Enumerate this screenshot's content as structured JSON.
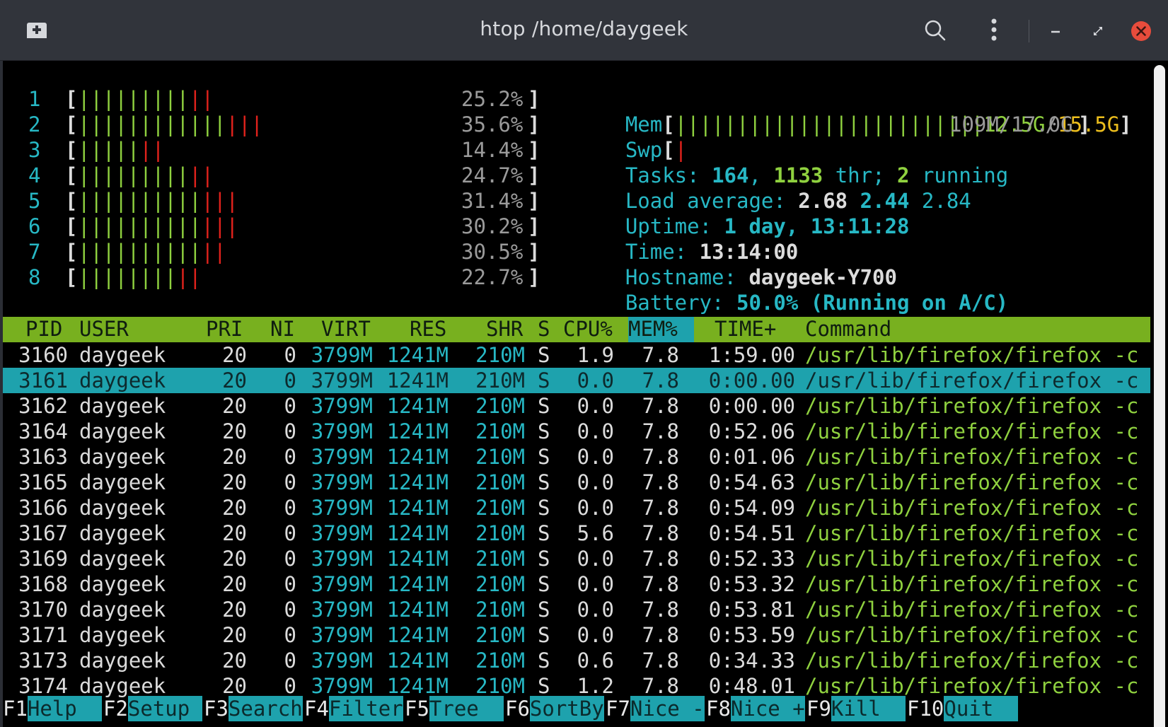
{
  "window": {
    "title": "htop /home/daygeek",
    "icons": [
      "new-tab-icon",
      "search-icon",
      "kebab-menu-icon",
      "minimize-icon",
      "restore-icon",
      "close-icon"
    ]
  },
  "colors": {
    "cyan": "#27b8c5",
    "green": "#8fd13f",
    "red": "#e0221c",
    "yellow": "#ecbe1d",
    "header_bg": "#78b01f",
    "selection_bg": "#1ea2ad",
    "close_button": "#e74c3c"
  },
  "cpus": [
    {
      "num": "1",
      "bars_normal": "|||||||||",
      "bars_kernel": "||",
      "percent": "25.2%"
    },
    {
      "num": "2",
      "bars_normal": "||||||||||||",
      "bars_kernel": "|||",
      "percent": "35.6%"
    },
    {
      "num": "3",
      "bars_normal": "|||||",
      "bars_kernel": "||",
      "percent": "14.4%"
    },
    {
      "num": "4",
      "bars_normal": "|||||||||",
      "bars_kernel": "||",
      "percent": "24.7%"
    },
    {
      "num": "5",
      "bars_normal": "||||||||||",
      "bars_kernel": "|||",
      "percent": "31.4%"
    },
    {
      "num": "6",
      "bars_normal": "||||||||||",
      "bars_kernel": "|||",
      "percent": "30.2%"
    },
    {
      "num": "7",
      "bars_normal": "||||||||||",
      "bars_kernel": "||",
      "percent": "30.5%"
    },
    {
      "num": "8",
      "bars_normal": "||||||||",
      "bars_kernel": "||",
      "percent": "22.7%"
    }
  ],
  "meters": {
    "mem_label": "Mem",
    "mem_bars": "|||||||||||||||||||||||||",
    "mem_used": "12.5G",
    "mem_sep": "/",
    "mem_total": "15.5G",
    "swp_label": "Swp",
    "swp_bars": "|",
    "swp_value": "109M/17.0G",
    "tasks_label": "Tasks:",
    "tasks": "164",
    "comma": ",",
    "threads": "1133",
    "thr_label": "thr;",
    "running": "2",
    "running_label": "running",
    "load_label": "Load average:",
    "load1": "2.68",
    "load5": "2.44",
    "load15": "2.84",
    "uptime_label": "Uptime:",
    "uptime": "1 day, 13:11:28",
    "time_label": "Time:",
    "time": "13:14:00",
    "hostname_label": "Hostname:",
    "hostname": "daygeek-Y700",
    "battery_label": "Battery:",
    "battery": "50.0% (Running on A/C)"
  },
  "columns": [
    "PID",
    "USER",
    "PRI",
    "NI",
    "VIRT",
    "RES",
    "SHR",
    "S",
    "CPU%",
    "MEM%",
    "TIME+",
    "Command"
  ],
  "sorted_column": "MEM%",
  "processes": [
    {
      "pid": "3160",
      "user": "daygeek",
      "pri": "20",
      "ni": "0",
      "virt": "3799M",
      "res": "1241M",
      "shr": "210M",
      "s": "S",
      "cpu": "1.9",
      "mem": "7.8",
      "time": "1:59.00",
      "cmd": "/usr/lib/firefox/firefox -c"
    },
    {
      "pid": "3161",
      "user": "daygeek",
      "pri": "20",
      "ni": "0",
      "virt": "3799M",
      "res": "1241M",
      "shr": "210M",
      "s": "S",
      "cpu": "0.0",
      "mem": "7.8",
      "time": "0:00.00",
      "cmd": "/usr/lib/firefox/firefox -c",
      "selected": true
    },
    {
      "pid": "3162",
      "user": "daygeek",
      "pri": "20",
      "ni": "0",
      "virt": "3799M",
      "res": "1241M",
      "shr": "210M",
      "s": "S",
      "cpu": "0.0",
      "mem": "7.8",
      "time": "0:00.00",
      "cmd": "/usr/lib/firefox/firefox -c"
    },
    {
      "pid": "3164",
      "user": "daygeek",
      "pri": "20",
      "ni": "0",
      "virt": "3799M",
      "res": "1241M",
      "shr": "210M",
      "s": "S",
      "cpu": "0.0",
      "mem": "7.8",
      "time": "0:52.06",
      "cmd": "/usr/lib/firefox/firefox -c"
    },
    {
      "pid": "3163",
      "user": "daygeek",
      "pri": "20",
      "ni": "0",
      "virt": "3799M",
      "res": "1241M",
      "shr": "210M",
      "s": "S",
      "cpu": "0.0",
      "mem": "7.8",
      "time": "0:01.06",
      "cmd": "/usr/lib/firefox/firefox -c"
    },
    {
      "pid": "3165",
      "user": "daygeek",
      "pri": "20",
      "ni": "0",
      "virt": "3799M",
      "res": "1241M",
      "shr": "210M",
      "s": "S",
      "cpu": "0.0",
      "mem": "7.8",
      "time": "0:54.63",
      "cmd": "/usr/lib/firefox/firefox -c"
    },
    {
      "pid": "3166",
      "user": "daygeek",
      "pri": "20",
      "ni": "0",
      "virt": "3799M",
      "res": "1241M",
      "shr": "210M",
      "s": "S",
      "cpu": "0.0",
      "mem": "7.8",
      "time": "0:54.09",
      "cmd": "/usr/lib/firefox/firefox -c"
    },
    {
      "pid": "3167",
      "user": "daygeek",
      "pri": "20",
      "ni": "0",
      "virt": "3799M",
      "res": "1241M",
      "shr": "210M",
      "s": "S",
      "cpu": "5.6",
      "mem": "7.8",
      "time": "0:54.51",
      "cmd": "/usr/lib/firefox/firefox -c"
    },
    {
      "pid": "3169",
      "user": "daygeek",
      "pri": "20",
      "ni": "0",
      "virt": "3799M",
      "res": "1241M",
      "shr": "210M",
      "s": "S",
      "cpu": "0.0",
      "mem": "7.8",
      "time": "0:52.33",
      "cmd": "/usr/lib/firefox/firefox -c"
    },
    {
      "pid": "3168",
      "user": "daygeek",
      "pri": "20",
      "ni": "0",
      "virt": "3799M",
      "res": "1241M",
      "shr": "210M",
      "s": "S",
      "cpu": "0.0",
      "mem": "7.8",
      "time": "0:53.32",
      "cmd": "/usr/lib/firefox/firefox -c"
    },
    {
      "pid": "3170",
      "user": "daygeek",
      "pri": "20",
      "ni": "0",
      "virt": "3799M",
      "res": "1241M",
      "shr": "210M",
      "s": "S",
      "cpu": "0.0",
      "mem": "7.8",
      "time": "0:53.81",
      "cmd": "/usr/lib/firefox/firefox -c"
    },
    {
      "pid": "3171",
      "user": "daygeek",
      "pri": "20",
      "ni": "0",
      "virt": "3799M",
      "res": "1241M",
      "shr": "210M",
      "s": "S",
      "cpu": "0.0",
      "mem": "7.8",
      "time": "0:53.59",
      "cmd": "/usr/lib/firefox/firefox -c"
    },
    {
      "pid": "3173",
      "user": "daygeek",
      "pri": "20",
      "ni": "0",
      "virt": "3799M",
      "res": "1241M",
      "shr": "210M",
      "s": "S",
      "cpu": "0.6",
      "mem": "7.8",
      "time": "0:34.33",
      "cmd": "/usr/lib/firefox/firefox -c"
    },
    {
      "pid": "3174",
      "user": "daygeek",
      "pri": "20",
      "ni": "0",
      "virt": "3799M",
      "res": "1241M",
      "shr": "210M",
      "s": "S",
      "cpu": "1.2",
      "mem": "7.8",
      "time": "0:48.01",
      "cmd": "/usr/lib/firefox/firefox -c"
    }
  ],
  "fkeys": [
    {
      "key": "F1",
      "label": "Help  "
    },
    {
      "key": "F2",
      "label": "Setup "
    },
    {
      "key": "F3",
      "label": "Search"
    },
    {
      "key": "F4",
      "label": "Filter"
    },
    {
      "key": "F5",
      "label": "Tree  "
    },
    {
      "key": "F6",
      "label": "SortBy"
    },
    {
      "key": "F7",
      "label": "Nice -"
    },
    {
      "key": "F8",
      "label": "Nice +"
    },
    {
      "key": "F9",
      "label": "Kill  "
    },
    {
      "key": "F10",
      "label": "Quit  "
    }
  ]
}
